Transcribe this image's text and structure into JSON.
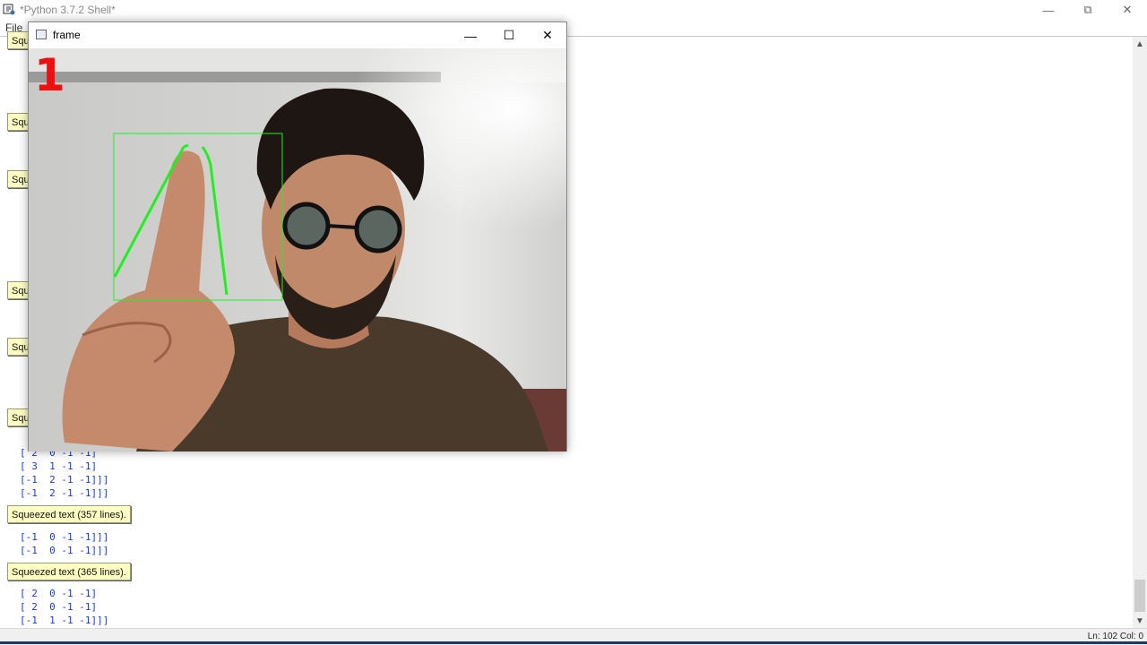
{
  "shell": {
    "title": "*Python 3.7.2 Shell*",
    "menu": [
      "File"
    ],
    "status": "Ln: 102   Col: 0"
  },
  "squeezed": [
    "Squeezed text (357 lines).",
    "Squeezed text (365 lines)."
  ],
  "output_lines": [
    "[ 2  0 -1 -1]",
    "[ 3  1 -1 -1]",
    "[-1  2 -1 -1]]]",
    "[-1  2 -1 -1]]]",
    "[-1  0 -1 -1]]]",
    "[-1  0 -1 -1]]]",
    "[ 2  0 -1 -1]",
    "[ 2  0 -1 -1]",
    "[-1  1 -1 -1]]]"
  ],
  "partial_labels": [
    "Squ",
    "Squ",
    "Squ",
    "Squ",
    "Squ",
    "Squ"
  ],
  "frame": {
    "title": "frame",
    "finger_count": "1"
  },
  "colors": {
    "detection_green": "#22ee22",
    "count_red": "#ee1010",
    "output_blue": "#1a3cc8"
  }
}
